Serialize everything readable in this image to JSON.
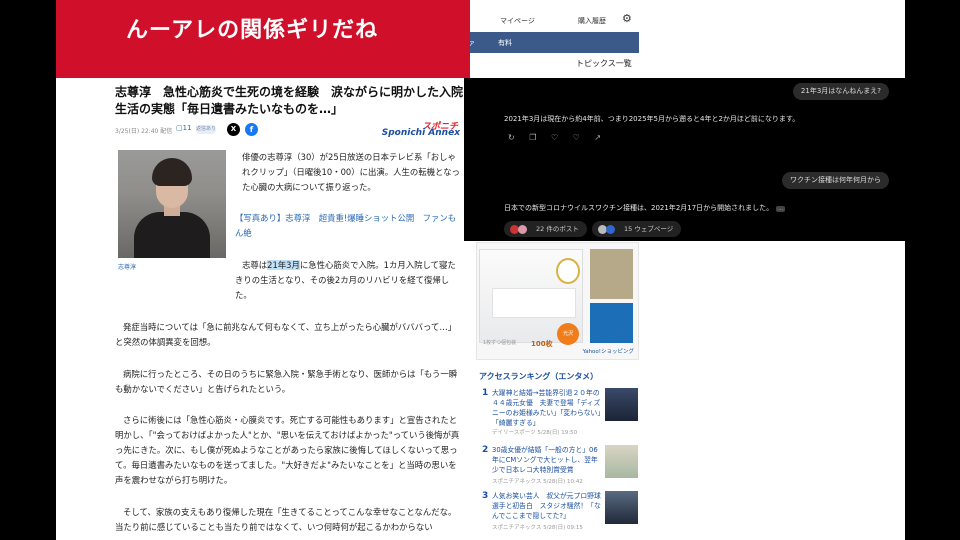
{
  "banner": {
    "text": "んーアレの関係ギリだね"
  },
  "topnav": {
    "mypage": "マイページ",
    "history": "購入履歴",
    "gear": "gear-icon"
  },
  "bluebar": {
    "item1": "ァ",
    "item2": "有料"
  },
  "topics": "トピックス一覧",
  "article": {
    "headline": "志尊淳　急性心筋炎で生死の境を経験　涙ながらに明かした入院生活の実態「毎日遺書みたいなものを…」",
    "meta": "3/25(日) 22:40 配信",
    "comments": "11",
    "comments_badge": "返信あり",
    "source_brand_top": "スポニチ",
    "source_brand_bottom": "Sponichi Annex",
    "photo_caption": "志尊淳",
    "p1": "俳優の志尊淳（30）が25日放送の日本テレビ系「おしゃれクリップ」（日曜後10・00）に出演。人生の転機となった心臓の大病について振り返った。",
    "p2_link": "【写真あり】志尊淳　超貴重!爆睡ショット公開　ファンもん絶",
    "p3_pre": "志尊は",
    "p3_hl": "21年3月",
    "p3_post": "に急性心筋炎で入院。1カ月入院して寝たきりの生活となり、その後2カ月のリハビリを経て復帰した。",
    "p4": "発症当時については「急に前兆なんて何もなくて、立ち上がったら心臓がバババって…」と突然の体調異変を回想。",
    "p5": "病院に行ったところ、その日のうちに緊急入院・緊急手術となり、医師からは「もう一瞬も動かないでください」と告げられたという。",
    "p6": "さらに術後には「急性心筋炎・心膜炎です。死亡する可能性もあります」と宣告されたと明かし、「\"会っておけばよかった人\"とか、\"思いを伝えておけばよかった\"っていう後悔が真っ先にきた。次に、もし僕が死ぬようなことがあったら家族に後悔してほしくないって思って。毎日遺書みたいなものを送ってました。\"大好きだよ\"みたいなことを」と当時の思いを声を震わせながら打ち明けた。",
    "p7": "そして、家族の支えもあり復帰した現在「生きてることってこんな幸せなことなんだな。当たり前に感じていることも当たり前ではなくて、いつ何時何が起こるかわからない"
  },
  "chat": {
    "q1": "21年3月はなんねんまえ?",
    "a1": "2021年3月は現在から約4年前、つまり2025年5月から遡ると4年と2か月ほど前になります。",
    "actions": "↻ ❐ ♡ ♡ ↗",
    "q2": "ワクチン接種は何年何月から",
    "a2": "日本での新型コロナウイルスワクチン接種は、2021年2月17日から開始されました。",
    "a2_more": "…",
    "posts": "22 件のポスト",
    "webpages": "15 ウェブページ"
  },
  "ad": {
    "count_label": "100枚",
    "badge": "光沢",
    "small": "1枚ずつ個包装",
    "yshop": "Yahoo!ショッピング"
  },
  "ranking": {
    "title": "アクセスランキング（エンタメ）",
    "items": [
      {
        "num": "1",
        "text": "大躍神と結婚→芸能界引退２０年の４４歳元女優　夫妻で登場「ディズニーのお姫様みたい」「変わらない」「綺麗すぎる」",
        "src": "デイリースポーツ 5/28(日) 19:50"
      },
      {
        "num": "2",
        "text": "30歳女優が結婚「一般の方と」06年にCMソングで大ヒットし、翌年少で日本レコ大特別賞受賞",
        "src": "スポニチアネックス 5/28(日) 10:42"
      },
      {
        "num": "3",
        "text": "人気お笑い芸人　叔父が元プロ野球選手と初告白　スタジオ騒然！「なんでここまで隠してた?」",
        "src": "スポニチアネックス 5/28(日) 09:15"
      }
    ]
  }
}
